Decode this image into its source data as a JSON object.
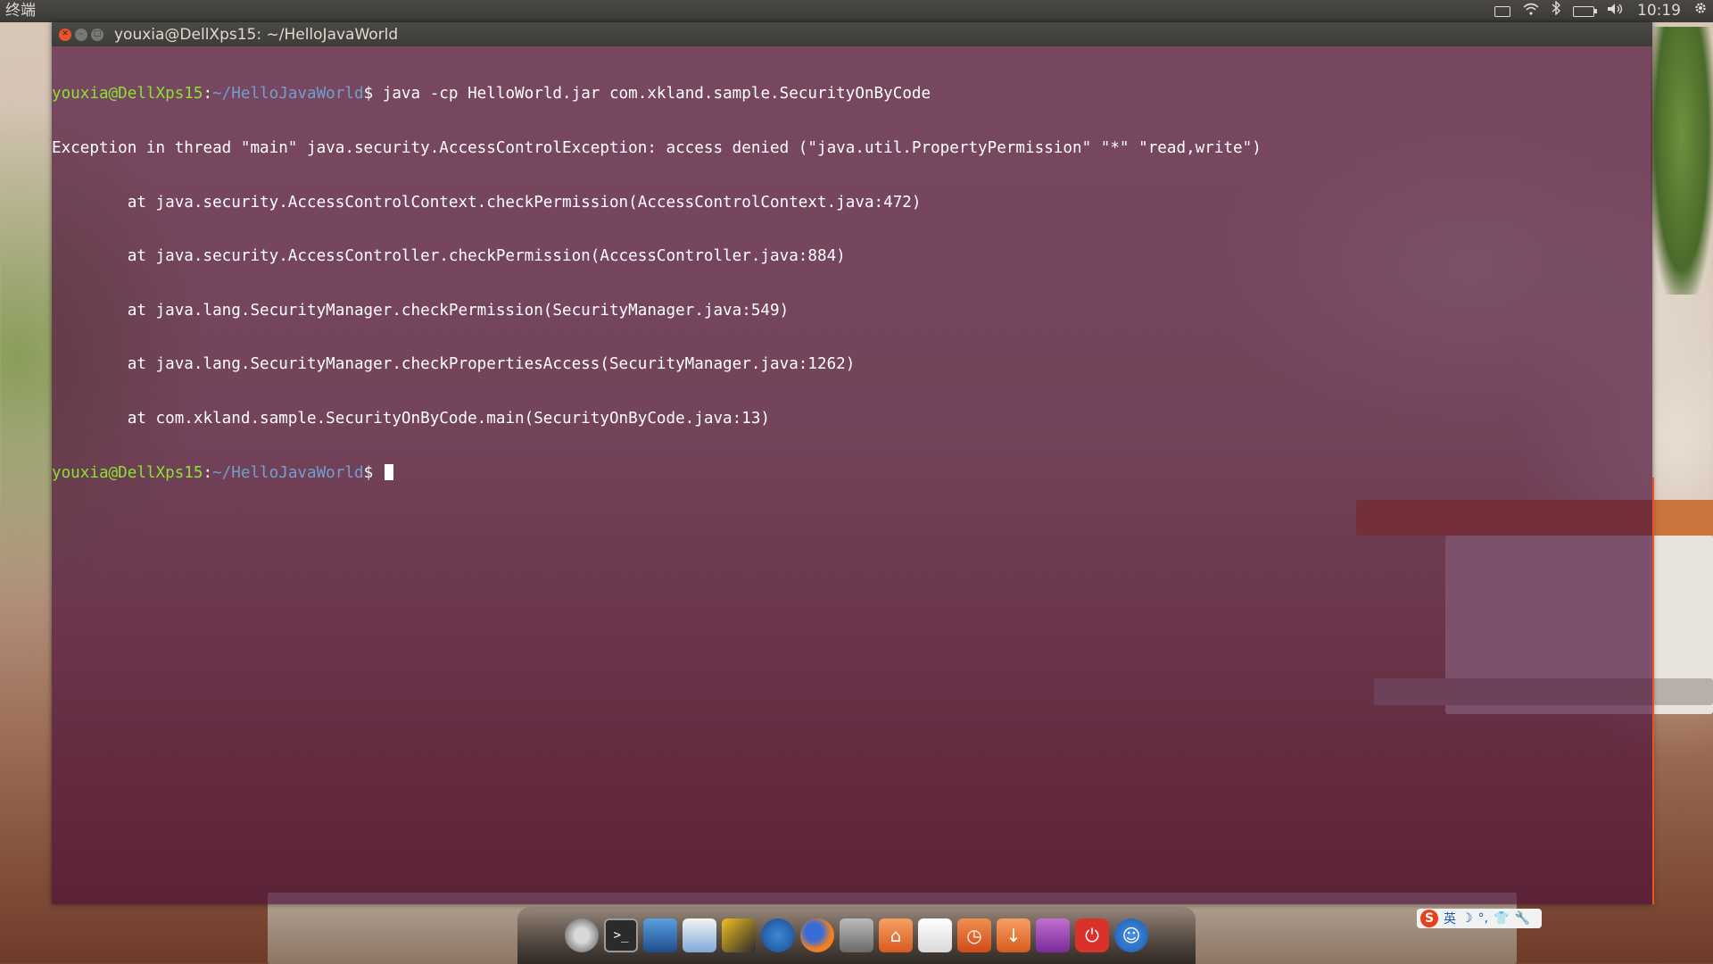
{
  "top_panel": {
    "app_name": "终端",
    "clock": "10:19",
    "indicators": [
      "keyboard-icon",
      "wifi-icon",
      "bluetooth-icon",
      "battery-icon",
      "volume-icon",
      "gear-icon"
    ]
  },
  "terminal": {
    "title": "youxia@DellXps15: ~/HelloJavaWorld",
    "prompt_user": "youxia@DellXps15",
    "prompt_path": "~/HelloJavaWorld",
    "prompt_symbol": "$",
    "command": " java -cp HelloWorld.jar com.xkland.sample.SecurityOnByCode",
    "output": [
      "Exception in thread \"main\" java.security.AccessControlException: access denied (\"java.util.PropertyPermission\" \"*\" \"read,write\")",
      "        at java.security.AccessControlContext.checkPermission(AccessControlContext.java:472)",
      "        at java.security.AccessController.checkPermission(AccessController.java:884)",
      "        at java.lang.SecurityManager.checkPermission(SecurityManager.java:549)",
      "        at java.lang.SecurityManager.checkPropertiesAccess(SecurityManager.java:1262)",
      "        at com.xkland.sample.SecurityOnByCode.main(SecurityOnByCode.java:13)"
    ]
  },
  "dock": {
    "items": [
      "settings-icon",
      "terminal-icon",
      "screenshot-icon",
      "writer-icon",
      "image-viewer-icon",
      "thunderbird-icon",
      "firefox-icon",
      "drive-icon",
      "home-folder-icon",
      "documents-icon",
      "recent-icon",
      "downloads-icon",
      "videos-icon",
      "power-icon",
      "accessibility-icon"
    ],
    "terminal_glyph": ">_"
  },
  "ime": {
    "logo": "S",
    "lang": "英"
  }
}
